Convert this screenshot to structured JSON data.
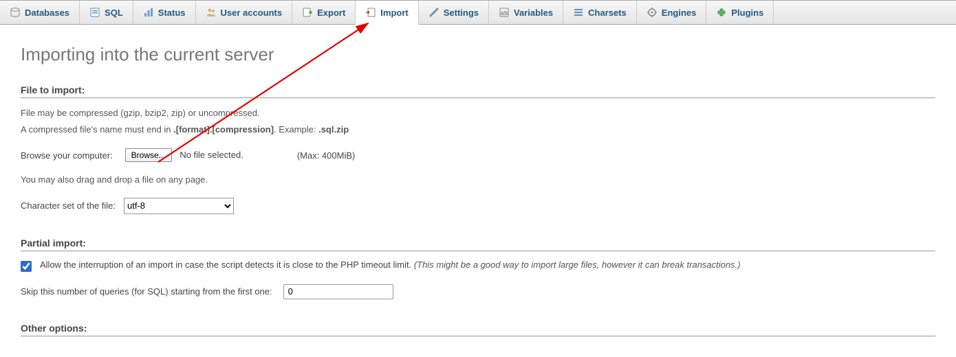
{
  "tabs": [
    {
      "label": "Databases",
      "icon": "databases-icon"
    },
    {
      "label": "SQL",
      "icon": "sql-icon"
    },
    {
      "label": "Status",
      "icon": "status-icon"
    },
    {
      "label": "User accounts",
      "icon": "users-icon"
    },
    {
      "label": "Export",
      "icon": "export-icon"
    },
    {
      "label": "Import",
      "icon": "import-icon",
      "active": true
    },
    {
      "label": "Settings",
      "icon": "settings-icon"
    },
    {
      "label": "Variables",
      "icon": "variables-icon"
    },
    {
      "label": "Charsets",
      "icon": "charsets-icon"
    },
    {
      "label": "Engines",
      "icon": "engines-icon"
    },
    {
      "label": "Plugins",
      "icon": "plugins-icon"
    }
  ],
  "page": {
    "title": "Importing into the current server",
    "file_section": {
      "heading": "File to import:",
      "hint1": "File may be compressed (gzip, bzip2, zip) or uncompressed.",
      "hint2_prefix": "A compressed file's name must end in ",
      "hint2_bold": ".[format].[compression]",
      "hint2_example_prefix": ". Example: ",
      "hint2_example_bold": ".sql.zip",
      "browse_label": "Browse your computer:",
      "browse_button": "Browse...",
      "file_status": "No file selected.",
      "max_size": "(Max: 400MiB)",
      "dragdrop": "You may also drag and drop a file on any page.",
      "charset_label": "Character set of the file:",
      "charset_value": "utf-8"
    },
    "partial_section": {
      "heading": "Partial import:",
      "allow_interrupt_checked": true,
      "allow_interrupt_text": "Allow the interruption of an import in case the script detects it is close to the PHP timeout limit. ",
      "allow_interrupt_hint": "(This might be a good way to import large files, however it can break transactions.)",
      "skip_label": "Skip this number of queries (for SQL) starting from the first one:",
      "skip_value": "0"
    },
    "other_section": {
      "heading": "Other options:"
    }
  }
}
